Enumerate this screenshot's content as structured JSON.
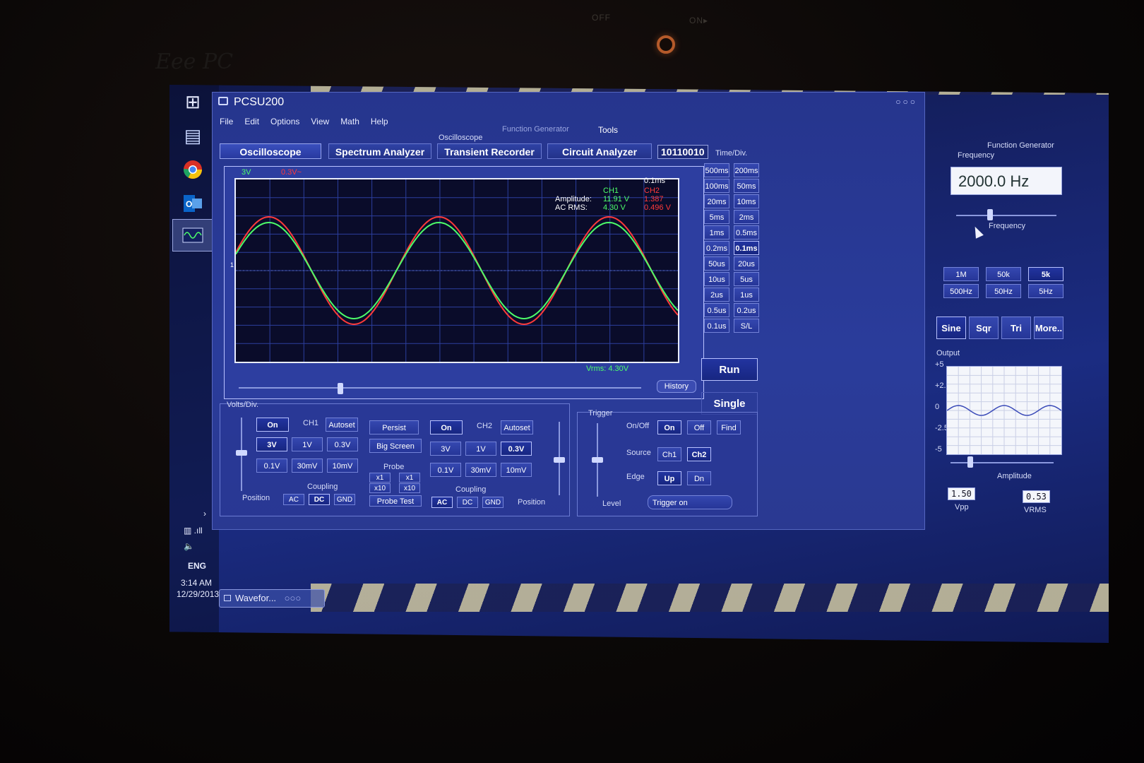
{
  "bezel": {
    "switch_off": "OFF",
    "switch_on": "ON▸",
    "brand": "Eee PC"
  },
  "window": {
    "title": "PCSU200",
    "controls": "○○○"
  },
  "menu": [
    "File",
    "Edit",
    "Options",
    "View",
    "Math",
    "Help"
  ],
  "labels": {
    "function_generator_tab": "Function Generator",
    "tools": "Tools",
    "oscilloscope_small": "Oscilloscope",
    "time_div": "Time/Div.",
    "fg_title": "Function Generator",
    "frequency": "Frequency",
    "frequency_slider": "Frequency",
    "output": "Output",
    "amplitude": "Amplitude",
    "vpp": "Vpp",
    "vrms": "VRMS",
    "volts_div": "Volts/Div.",
    "position": "Position",
    "coupling": "Coupling",
    "probe": "Probe",
    "trigger": "Trigger",
    "on_off": "On/Off",
    "source": "Source",
    "edge": "Edge",
    "level": "Level"
  },
  "tabs": [
    "Oscilloscope",
    "Spectrum Analyzer",
    "Transient Recorder",
    "Circuit Analyzer"
  ],
  "binary_display": "10110010",
  "scope": {
    "ch1_scale": "3V",
    "ch2_scale": "0.3V~",
    "timebase": "0.1ms",
    "ch1_label": "CH1",
    "ch2_label": "CH2",
    "amplitude_label": "Amplitude:",
    "acrms_label": "AC RMS:",
    "ch1_amplitude": "11.91 V",
    "ch2_amplitude": "1.387",
    "ch1_acrms": "4.30 V",
    "ch2_acrms": "0.496 V",
    "vrms": "Vrms: 4.30V",
    "marker": "1",
    "history": "History",
    "colors": {
      "ch1": "#4dff6a",
      "ch2": "#ff3a3a",
      "overlap": "#f0e24a",
      "grid": "#2c3f9e"
    }
  },
  "timediv": [
    [
      "500ms",
      "200ms"
    ],
    [
      "100ms",
      "50ms"
    ],
    [
      "20ms",
      "10ms"
    ],
    [
      "5ms",
      "2ms"
    ],
    [
      "1ms",
      "0.5ms"
    ],
    [
      "0.2ms",
      "0.1ms"
    ],
    [
      "50us",
      "20us"
    ],
    [
      "10us",
      "5us"
    ],
    [
      "2us",
      "1us"
    ],
    [
      "0.5us",
      "0.2us"
    ],
    [
      "0.1us",
      "S/L"
    ]
  ],
  "run": "Run",
  "single": "Single",
  "ch1": {
    "on": "On",
    "name": "CH1",
    "autoset": "Autoset",
    "volts": [
      "3V",
      "1V",
      "0.3V",
      "0.1V",
      "30mV",
      "10mV"
    ],
    "coupling": [
      "AC",
      "DC",
      "GND"
    ]
  },
  "middle": {
    "persist": "Persist",
    "big_screen": "Big Screen",
    "probe_test": "Probe Test",
    "x1a": "x1",
    "x10a": "x10",
    "x1b": "x1",
    "x10b": "x10"
  },
  "ch2": {
    "on": "On",
    "name": "CH2",
    "autoset": "Autoset",
    "volts": [
      "3V",
      "1V",
      "0.3V",
      "0.1V",
      "30mV",
      "10mV"
    ],
    "coupling": [
      "AC",
      "DC",
      "GND"
    ]
  },
  "trigger": {
    "on": "On",
    "off": "Off",
    "find": "Find",
    "ch1": "Ch1",
    "ch2": "Ch2",
    "up": "Up",
    "dn": "Dn",
    "trigger_on": "Trigger on"
  },
  "fg": {
    "frequency_value": "2000.0 Hz",
    "ranges": [
      "1M",
      "50k",
      "5k",
      "500Hz",
      "50Hz",
      "5Hz"
    ],
    "waves": [
      "Sine",
      "Sqr",
      "Tri",
      "More.."
    ],
    "y_ticks": [
      "+5",
      "+2.5",
      "0",
      "-2.5",
      "-5"
    ],
    "vpp_value": "1.50",
    "vrms_value": "0.53"
  },
  "taskbar": {
    "lang": "ENG",
    "time": "3:14 AM",
    "date": "12/29/2013",
    "waveform_item": "Wavefor...",
    "waveform_dots": "○○○"
  }
}
